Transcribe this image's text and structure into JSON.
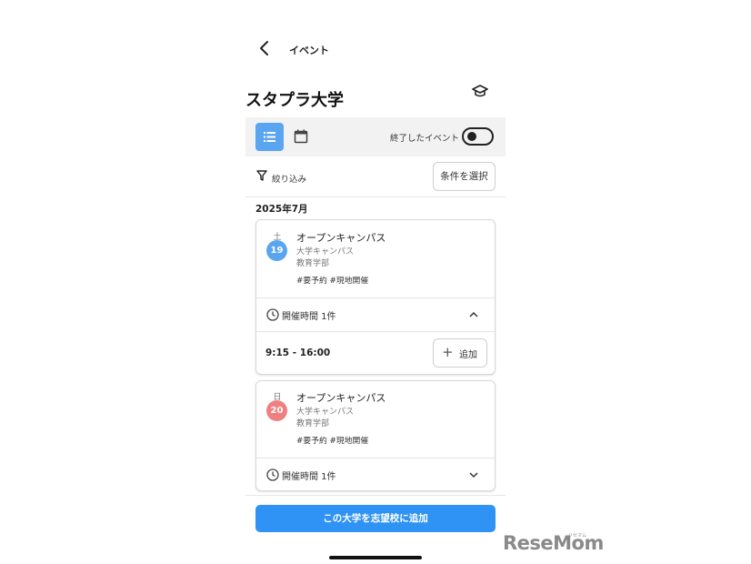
{
  "header": {
    "title": "イベント"
  },
  "university": {
    "name": "スタプラ大学"
  },
  "toolbar": {
    "ended_label": "終了したイベント",
    "ended_toggle_on": false
  },
  "filter": {
    "label": "絞り込み",
    "condition_button": "条件を選択"
  },
  "month": "2025年7月",
  "events": [
    {
      "dow": "土",
      "day": "19",
      "day_color": "#5aa5f0",
      "title": "オープンキャンパス",
      "location": "大学キャンパス",
      "faculty": "教育学部",
      "tags": "#要予約  #現地開催",
      "hours_label": "開催時間 1件",
      "expanded": true,
      "time": "9:15 - 16:00",
      "add_label": "追加"
    },
    {
      "dow": "日",
      "day": "20",
      "day_color": "#f07f7f",
      "title": "オープンキャンパス",
      "location": "大学キャンパス",
      "faculty": "教育学部",
      "tags": "#要予約  #現地開催",
      "hours_label": "開催時間 1件",
      "expanded": false
    }
  ],
  "cta": {
    "label": "この大学を志望校に追加"
  },
  "watermark": {
    "logo": "ReseMom",
    "small": "リセマム"
  }
}
